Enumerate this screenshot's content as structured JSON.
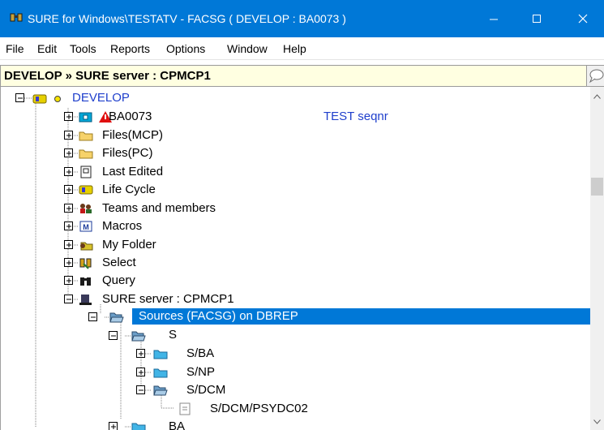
{
  "window": {
    "title": "SURE for Windows\\TESTATV - FACSG ( DEVELOP : BA0073 )",
    "icon": "binoculars-icon",
    "controls": [
      "minimize-icon",
      "maximize-icon",
      "close-icon"
    ]
  },
  "menu": {
    "items": [
      "File",
      "Edit",
      "Tools",
      "Reports",
      "Options",
      "Window",
      "Help"
    ]
  },
  "pathbar": {
    "text": "DEVELOP » SURE server : CPMCP1"
  },
  "tree": {
    "root": {
      "label": "DEVELOP",
      "icon": "develop-node-icon",
      "expanded": true
    },
    "nodes": [
      {
        "label": "BA0073",
        "icon": "warning-triangle-icon",
        "annotation": "TEST seqnr",
        "expanded": false
      },
      {
        "label": "Files(MCP)",
        "icon": "folder-icon",
        "expanded": false
      },
      {
        "label": "Files(PC)",
        "icon": "folder-icon",
        "expanded": false
      },
      {
        "label": "Last Edited",
        "icon": "document-edit-icon",
        "expanded": false
      },
      {
        "label": "Life Cycle",
        "icon": "lifecycle-icon",
        "expanded": false
      },
      {
        "label": "Teams and members",
        "icon": "team-icon",
        "expanded": false
      },
      {
        "label": "Macros",
        "icon": "macro-icon",
        "expanded": false
      },
      {
        "label": "My Folder",
        "icon": "my-folder-icon",
        "expanded": false
      },
      {
        "label": "Select",
        "icon": "select-icon",
        "expanded": false
      },
      {
        "label": "Query",
        "icon": "binoculars-icon",
        "expanded": false
      },
      {
        "label": "SURE server : CPMCP1",
        "icon": "server-icon",
        "expanded": true
      }
    ],
    "server_children": [
      {
        "label": "Sources  (FACSG) on DBREP",
        "icon": "open-folder-icon",
        "expanded": true,
        "selected": true
      }
    ],
    "source_children": [
      {
        "label": "S",
        "icon": "open-folder-icon",
        "expanded": true
      }
    ],
    "s_children": [
      {
        "label": "S/BA",
        "icon": "folder-icon",
        "expanded": false
      },
      {
        "label": "S/NP",
        "icon": "folder-icon",
        "expanded": false
      },
      {
        "label": "S/DCM",
        "icon": "open-folder-icon",
        "expanded": true
      }
    ],
    "dcm_children": [
      {
        "label": "S/DCM/PSYDC02",
        "icon": "file-icon"
      }
    ],
    "after_s": [
      {
        "label": "BA",
        "icon": "folder-icon",
        "expanded": false
      }
    ]
  },
  "colors": {
    "titlebar": "#0078d7",
    "selection": "#0078d7",
    "pathbar_bg": "#ffffe1",
    "root_label": "#1f3fcc"
  }
}
